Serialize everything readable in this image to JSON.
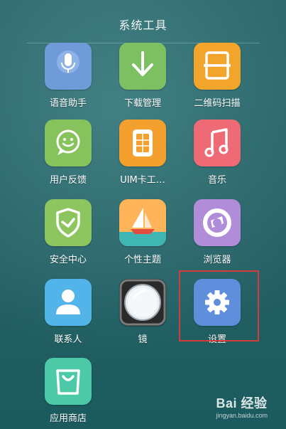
{
  "folder": {
    "title": "系统工具"
  },
  "apps": [
    {
      "label": "语音助手",
      "icon": "microphone-icon",
      "color": "#6f9bd8"
    },
    {
      "label": "下载管理",
      "icon": "download-arrow-icon",
      "color": "#7cc062"
    },
    {
      "label": "二维码扫描",
      "icon": "qr-scan-icon",
      "color": "#f2a52a"
    },
    {
      "label": "用户反馈",
      "icon": "chat-smile-icon",
      "color": "#86c35c"
    },
    {
      "label": "UIM卡工…",
      "icon": "sim-card-icon",
      "color": "#f3a02e"
    },
    {
      "label": "音乐",
      "icon": "music-note-icon",
      "color": "#ee6b76"
    },
    {
      "label": "安全中心",
      "icon": "shield-icon",
      "color": "#8dc55f"
    },
    {
      "label": "个性主题",
      "icon": "sailboat-icon",
      "color": "#ffb45a"
    },
    {
      "label": "浏览器",
      "icon": "browser-logo-icon",
      "color": "#b08cd9"
    },
    {
      "label": "联系人",
      "icon": "person-icon",
      "color": "#52b4e8"
    },
    {
      "label": "镜",
      "icon": "mirror-icon",
      "color": "#2a2a2a"
    },
    {
      "label": "设置",
      "icon": "gear-icon",
      "color": "#5f8fdc"
    },
    {
      "label": "应用商店",
      "icon": "shopping-bag-icon",
      "color": "#4cc9a6"
    }
  ],
  "watermark": {
    "brand": "Bai 经验",
    "url": "jingyan.baidu.com"
  },
  "highlight_color": "#d43b3b"
}
